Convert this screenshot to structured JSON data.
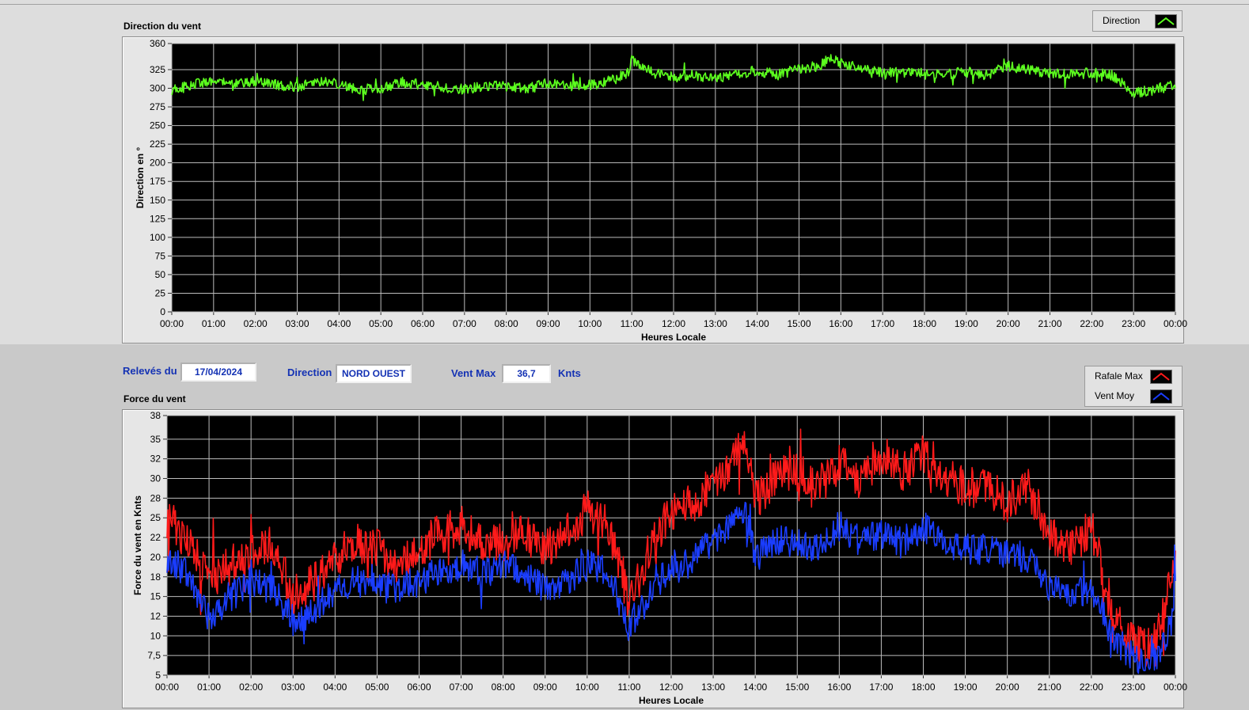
{
  "direction_panel": {
    "title": "Direction du vent",
    "legend_label": "Direction"
  },
  "force_panel": {
    "title": "Force du vent",
    "legend": [
      "Rafale Max",
      "Vent Moy"
    ]
  },
  "info_bar": {
    "releves_label": "Relevés du",
    "releves_value": "17/04/2024",
    "direction_label": "Direction",
    "direction_value": "NORD OUEST",
    "ventmax_label": "Vent Max",
    "ventmax_value": "36,7",
    "ventmax_unit": "Knts"
  },
  "colors": {
    "direction": "#5cff1e",
    "rafale": "#ff1a1a",
    "vent_moy": "#1a3dff",
    "plot_bg": "#000000",
    "grid": "#bdbdbd",
    "label_blue": "#1432b4"
  },
  "chart_data": [
    {
      "type": "line",
      "title": "Direction du vent",
      "xlabel": "Heures Locale",
      "ylabel": "Direction en °",
      "ylim": [
        0,
        360
      ],
      "yticks": [
        "0",
        "25",
        "50",
        "75",
        "100",
        "125",
        "150",
        "175",
        "200",
        "225",
        "250",
        "275",
        "300",
        "325",
        "360"
      ],
      "xticks": [
        "00:00",
        "01:00",
        "02:00",
        "03:00",
        "04:00",
        "05:00",
        "06:00",
        "07:00",
        "08:00",
        "09:00",
        "10:00",
        "11:00",
        "12:00",
        "13:00",
        "14:00",
        "15:00",
        "16:00",
        "17:00",
        "18:00",
        "19:00",
        "20:00",
        "21:00",
        "22:00",
        "23:00",
        "00:00"
      ],
      "grid": true,
      "legend_position": "top-right",
      "x_hours": [
        0,
        0.5,
        1,
        1.5,
        2,
        2.5,
        3,
        3.5,
        4,
        4.5,
        5,
        5.5,
        6,
        6.5,
        7,
        7.5,
        8,
        8.5,
        9,
        9.5,
        10,
        10.5,
        10.9,
        11,
        11.5,
        12,
        12.5,
        13,
        13.5,
        14,
        14.5,
        15,
        15.5,
        15.75,
        16,
        16.5,
        17,
        17.5,
        18,
        18.5,
        19,
        19.5,
        20,
        20.5,
        21,
        21.5,
        22,
        22.5,
        22.8,
        23,
        23.5,
        24
      ],
      "series": [
        {
          "name": "Direction",
          "values": [
            298,
            305,
            311,
            306,
            309,
            304,
            302,
            310,
            306,
            298,
            300,
            308,
            305,
            301,
            299,
            303,
            302,
            299,
            307,
            303,
            304,
            310,
            320,
            338,
            322,
            315,
            318,
            312,
            320,
            323,
            318,
            326,
            330,
            342,
            333,
            326,
            320,
            322,
            318,
            319,
            322,
            318,
            330,
            325,
            320,
            318,
            321,
            317,
            305,
            294,
            298,
            304
          ]
        }
      ]
    },
    {
      "type": "line",
      "title": "Force du vent",
      "xlabel": "Heures Locale",
      "ylabel": "Force du vent en Knts",
      "ylim": [
        5,
        38
      ],
      "yticks": [
        "5",
        "7,5",
        "10",
        "12",
        "15",
        "18",
        "20",
        "22",
        "25",
        "28",
        "30",
        "32",
        "35",
        "38"
      ],
      "xticks": [
        "00:00",
        "01:00",
        "02:00",
        "03:00",
        "04:00",
        "05:00",
        "06:00",
        "07:00",
        "08:00",
        "09:00",
        "10:00",
        "11:00",
        "12:00",
        "13:00",
        "14:00",
        "15:00",
        "16:00",
        "17:00",
        "18:00",
        "19:00",
        "20:00",
        "21:00",
        "22:00",
        "23:00",
        "00:00"
      ],
      "grid": true,
      "legend_position": "top-right",
      "x_hours": [
        0,
        0.5,
        1,
        1.5,
        2,
        2.5,
        3,
        3.5,
        4,
        4.5,
        5,
        5.5,
        6,
        6.5,
        7,
        7.5,
        8,
        8.5,
        9,
        9.5,
        10,
        10.5,
        11,
        11.5,
        12,
        12.5,
        13,
        13.5,
        13.75,
        14,
        14.5,
        15,
        15.5,
        16,
        16.5,
        17,
        17.5,
        18,
        18.5,
        19,
        19.5,
        20,
        20.5,
        21,
        21.5,
        22,
        22.5,
        23,
        23.3,
        23.6,
        23.9,
        24
      ],
      "series": [
        {
          "name": "Rafale Max",
          "values": [
            25,
            22,
            17,
            19,
            20,
            22,
            15,
            17,
            20,
            22,
            21,
            19,
            21,
            23,
            24,
            22,
            22,
            23,
            21,
            23,
            26,
            24,
            14,
            21,
            26,
            27,
            29,
            32,
            36,
            27,
            30,
            31,
            29,
            32,
            30,
            33,
            31,
            33,
            30,
            29,
            29,
            27,
            29,
            23,
            21,
            24,
            13,
            9,
            8.5,
            11,
            18,
            21
          ]
        },
        {
          "name": "Vent Moy",
          "values": [
            20,
            18,
            12,
            15,
            17,
            16,
            12,
            13,
            16,
            17,
            16,
            16,
            17,
            18,
            19,
            18,
            19,
            18,
            16,
            17,
            19,
            18,
            11,
            15,
            19,
            20,
            22,
            24,
            26,
            20,
            22,
            22,
            21,
            24,
            22,
            23,
            22,
            24,
            22,
            21,
            21,
            20,
            20,
            16,
            15,
            16,
            10,
            7,
            6,
            8,
            12,
            17
          ]
        }
      ]
    }
  ]
}
